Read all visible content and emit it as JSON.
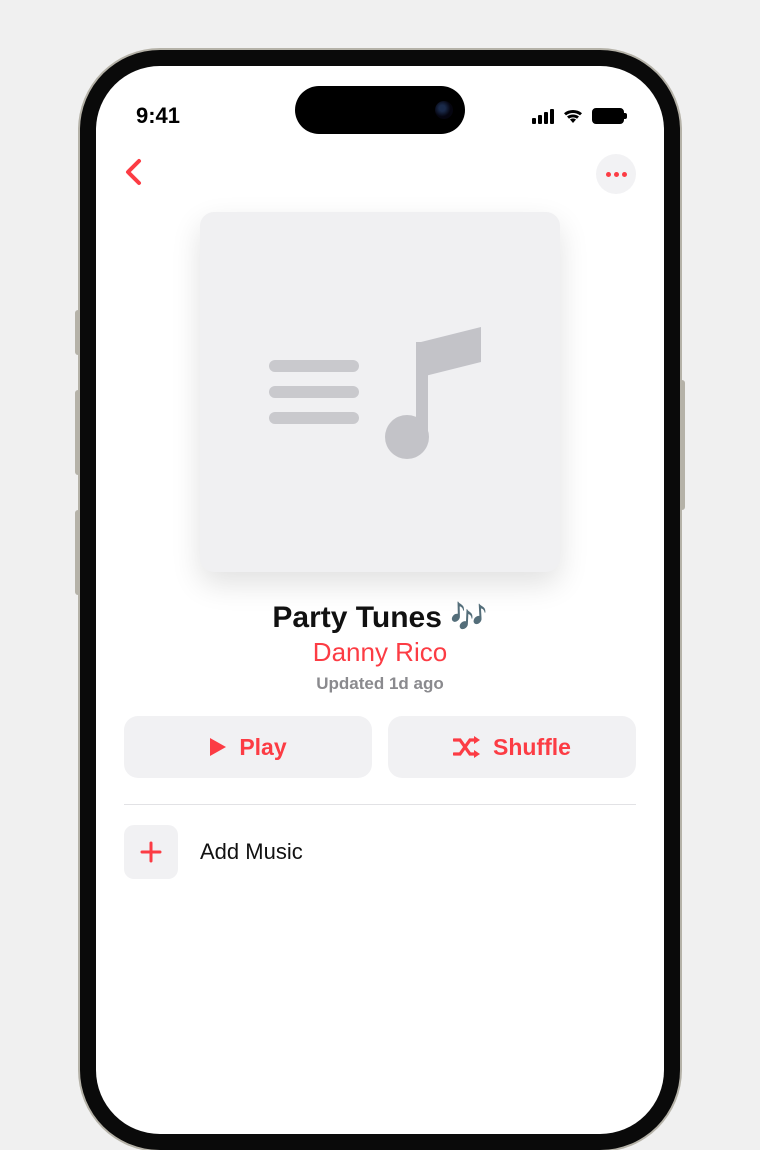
{
  "status": {
    "time": "9:41"
  },
  "playlist": {
    "title": "Party Tunes 🎶",
    "author": "Danny Rico",
    "updated": "Updated 1d ago"
  },
  "actions": {
    "play": "Play",
    "shuffle": "Shuffle",
    "add_music": "Add Music"
  },
  "colors": {
    "accent": "#fc3c44"
  }
}
